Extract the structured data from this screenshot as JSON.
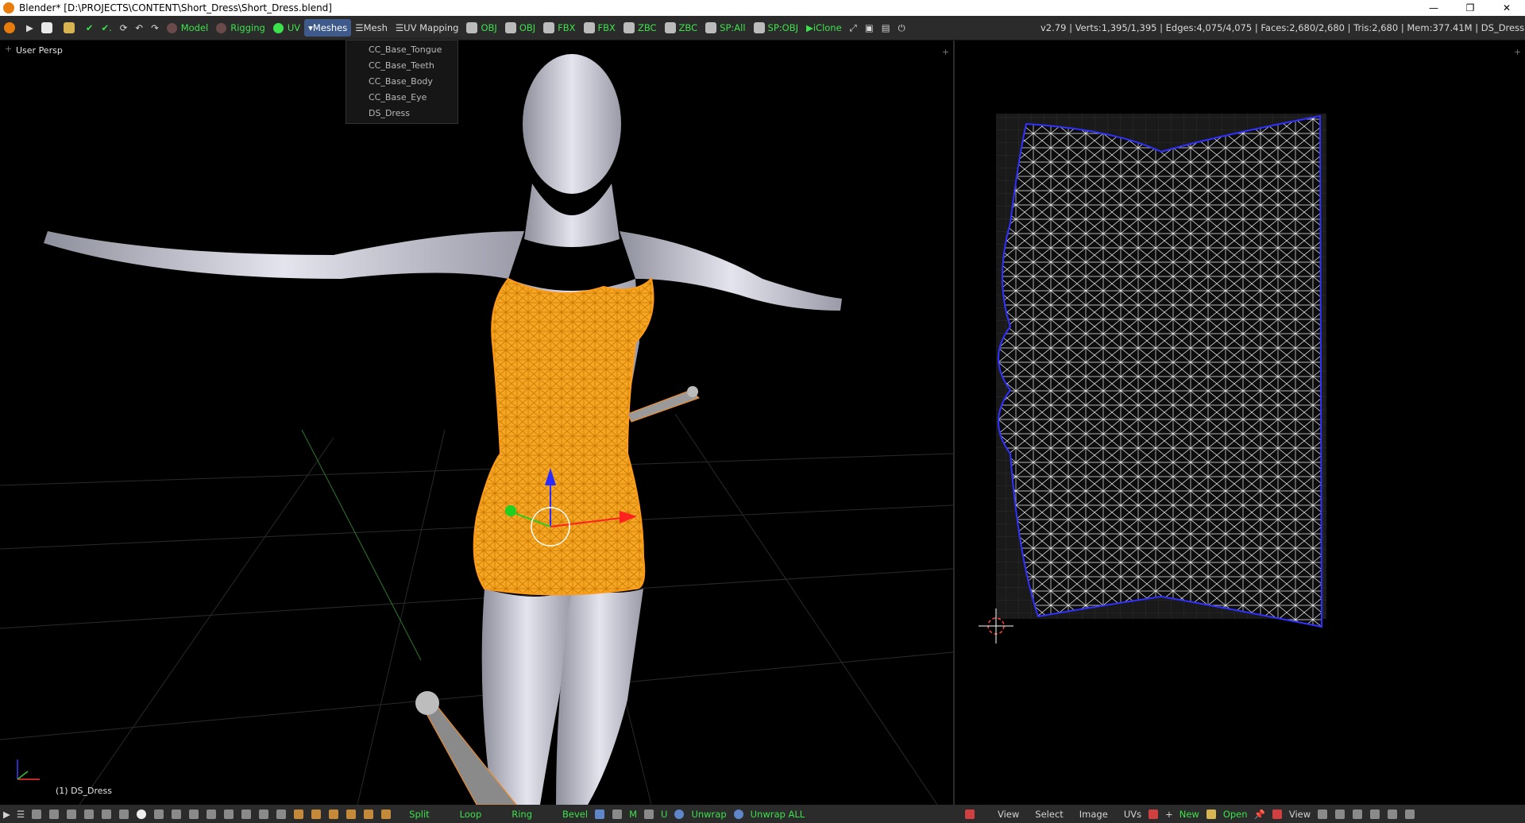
{
  "window": {
    "title": "Blender* [D:\\PROJECTS\\CONTENT\\Short_Dress\\Short_Dress.blend]",
    "minimize": "—",
    "restore": "❐",
    "close": "✕"
  },
  "toolbar": {
    "model": "Model",
    "rigging": "Rigging",
    "uv": "UV",
    "meshes": "Meshes",
    "mesh": "Mesh",
    "uv_mapping": "UV Mapping",
    "exports": [
      "OBJ",
      "OBJ",
      "FBX",
      "FBX",
      "ZBC",
      "ZBC",
      "SP:All",
      "SP:OBJ"
    ],
    "iclone": "iClone",
    "stats": "v2.79 | Verts:1,395/1,395 | Edges:4,075/4,075 | Faces:2,680/2,680 | Tris:2,680 | Mem:377.41M | DS_Dress"
  },
  "meshes_menu": [
    "CC_Base_Tongue",
    "CC_Base_Teeth",
    "CC_Base_Body",
    "CC_Base_Eye",
    "DS_Dress"
  ],
  "viewport": {
    "view_label": "User Persp",
    "active_object": "(1) DS_Dress"
  },
  "bottom_left": [
    "Split",
    "Loop",
    "Ring",
    "Bevel",
    "M",
    "U",
    "Unwrap",
    "Unwrap ALL"
  ],
  "bottom_right": {
    "menus": [
      "View",
      "Select",
      "Image",
      "UVs"
    ],
    "new": "New",
    "open": "Open",
    "view": "View"
  },
  "colors": {
    "selection": "#ff9a17",
    "uv_wire": "#ffffff",
    "uv_edge": "#3030ff",
    "accent_green": "#3ce24b"
  }
}
